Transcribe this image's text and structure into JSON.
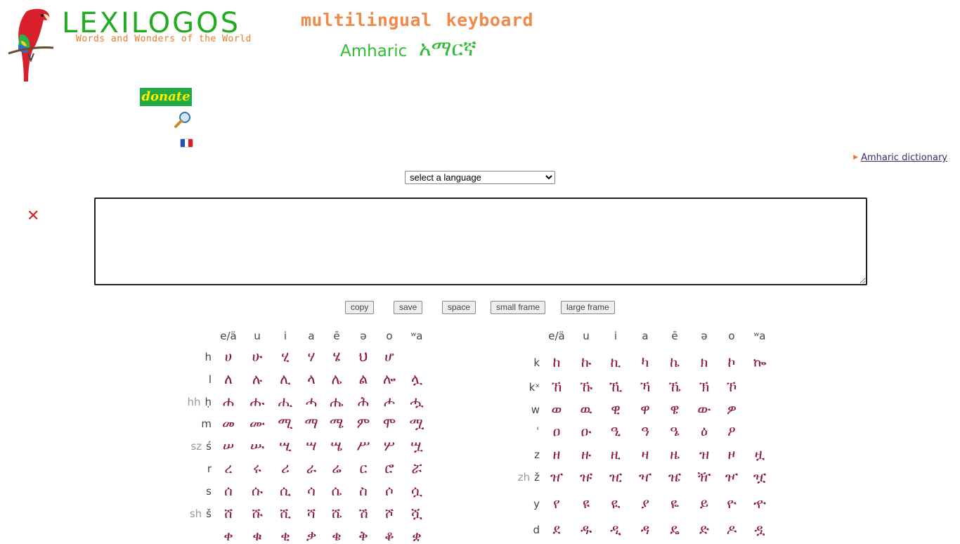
{
  "header": {
    "logo_text": "LEXILOGOS",
    "tagline": "Words and Wonders of the World",
    "title_words": [
      "multilingual",
      "keyboard"
    ],
    "language_en": "Amharic",
    "language_native": "አማርኛ"
  },
  "sidebar": {
    "donate_label": "donate"
  },
  "dictionary_link": "Amharic dictionary",
  "language_select": {
    "selected": "select a language"
  },
  "editor": {
    "value": "",
    "clear_symbol": "✕"
  },
  "buttons": {
    "copy": "copy",
    "save": "save",
    "space": "space",
    "small_frame": "small frame",
    "large_frame": "large frame"
  },
  "colors": {
    "logo_green": "#22aa22",
    "title_orange": "#f08a4b",
    "char_red": "#8b1a3a",
    "donate_bg": "#22aa44"
  },
  "left_grid": {
    "headers": [
      "e/ä",
      "u",
      "i",
      "a",
      "ē",
      "ə",
      "o",
      "ʷa"
    ],
    "rows": [
      {
        "label": "h",
        "alt": "",
        "chars": [
          "ሀ",
          "ሁ",
          "ሂ",
          "ሃ",
          "ሄ",
          "ህ",
          "ሆ",
          ""
        ]
      },
      {
        "label": "l",
        "alt": "",
        "chars": [
          "ለ",
          "ሉ",
          "ሊ",
          "ላ",
          "ሌ",
          "ል",
          "ሎ",
          "ሏ"
        ]
      },
      {
        "label": "ḥ",
        "alt": "hh",
        "chars": [
          "ሐ",
          "ሑ",
          "ሒ",
          "ሓ",
          "ሔ",
          "ሕ",
          "ሖ",
          "ሗ"
        ]
      },
      {
        "label": "m",
        "alt": "",
        "chars": [
          "መ",
          "ሙ",
          "ሚ",
          "ማ",
          "ሜ",
          "ም",
          "ሞ",
          "ሟ"
        ]
      },
      {
        "label": "ś",
        "alt": "sz",
        "chars": [
          "ሠ",
          "ሡ",
          "ሢ",
          "ሣ",
          "ሤ",
          "ሥ",
          "ሦ",
          "ሧ"
        ]
      },
      {
        "label": "r",
        "alt": "",
        "chars": [
          "ረ",
          "ሩ",
          "ሪ",
          "ራ",
          "ሬ",
          "ር",
          "ሮ",
          "ሯ"
        ]
      },
      {
        "label": "s",
        "alt": "",
        "chars": [
          "ሰ",
          "ሱ",
          "ሲ",
          "ሳ",
          "ሴ",
          "ስ",
          "ሶ",
          "ሷ"
        ]
      },
      {
        "label": "š",
        "alt": "sh",
        "chars": [
          "ሸ",
          "ሹ",
          "ሺ",
          "ሻ",
          "ሼ",
          "ሽ",
          "ሾ",
          "ሿ"
        ]
      },
      {
        "label": "",
        "alt": "",
        "chars": [
          "ቀ",
          "ቁ",
          "ቂ",
          "ቃ",
          "ቄ",
          "ቅ",
          "ቆ",
          "ቋ"
        ]
      }
    ]
  },
  "right_grid": {
    "headers": [
      "e/ä",
      "u",
      "i",
      "a",
      "ē",
      "ə",
      "o",
      "ʷa"
    ],
    "rows": [
      {
        "label": "k",
        "alt": "",
        "chars": [
          "ከ",
          "ኩ",
          "ኪ",
          "ካ",
          "ኬ",
          "ክ",
          "ኮ",
          "ኰ"
        ]
      },
      {
        "label": "kˣ",
        "alt": "",
        "chars": [
          "ኸ",
          "ኹ",
          "ኺ",
          "ኻ",
          "ኼ",
          "ኽ",
          "ኾ",
          ""
        ]
      },
      {
        "label": "w",
        "alt": "",
        "chars": [
          "ወ",
          "ዉ",
          "ዊ",
          "ዋ",
          "ዌ",
          "ው",
          "ዎ",
          ""
        ]
      },
      {
        "label": "ʿ",
        "alt": "",
        "chars": [
          "ዐ",
          "ዑ",
          "ዒ",
          "ዓ",
          "ዔ",
          "ዕ",
          "ዖ",
          ""
        ]
      },
      {
        "label": "z",
        "alt": "",
        "chars": [
          "ዘ",
          "ዙ",
          "ዚ",
          "ዛ",
          "ዜ",
          "ዝ",
          "ዞ",
          "ዟ"
        ]
      },
      {
        "label": "ž",
        "alt": "zh",
        "chars": [
          "ዠ",
          "ዡ",
          "ዢ",
          "ዣ",
          "ዤ",
          "ዥ",
          "ዦ",
          "ዧ"
        ]
      },
      {
        "label": "y",
        "alt": "",
        "chars": [
          "የ",
          "ዩ",
          "ዪ",
          "ያ",
          "ዬ",
          "ይ",
          "ዮ",
          "ዯ"
        ]
      },
      {
        "label": "d",
        "alt": "",
        "chars": [
          "ደ",
          "ዱ",
          "ዲ",
          "ዳ",
          "ዴ",
          "ድ",
          "ዶ",
          "ዷ"
        ]
      }
    ]
  }
}
